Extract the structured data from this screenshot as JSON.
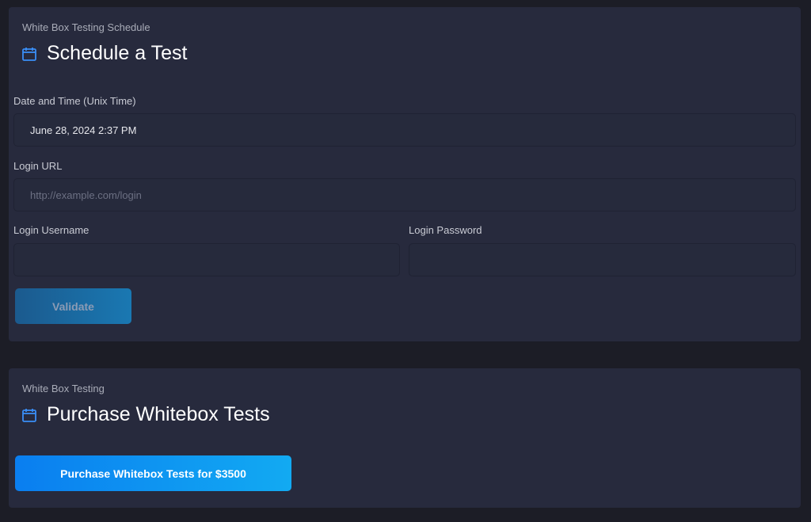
{
  "schedule": {
    "eyebrow": "White Box Testing Schedule",
    "title": "Schedule a Test",
    "title_icon": "calendar-icon",
    "datetime": {
      "label": "Date and Time (Unix Time)",
      "value": "June 28, 2024 2:37 PM"
    },
    "login_url": {
      "label": "Login URL",
      "value": "",
      "placeholder": "http://example.com/login"
    },
    "login_username": {
      "label": "Login Username",
      "value": ""
    },
    "login_password": {
      "label": "Login Password",
      "value": ""
    },
    "validate_label": "Validate"
  },
  "purchase": {
    "eyebrow": "White Box Testing",
    "title": "Purchase Whitebox Tests",
    "title_icon": "calendar-icon",
    "button_label": "Purchase Whitebox Tests for $3500"
  },
  "colors": {
    "page_bg": "#1c1d26",
    "card_bg": "#272a3d",
    "accent": "#1e90ff",
    "icon": "#3a8ef6"
  }
}
